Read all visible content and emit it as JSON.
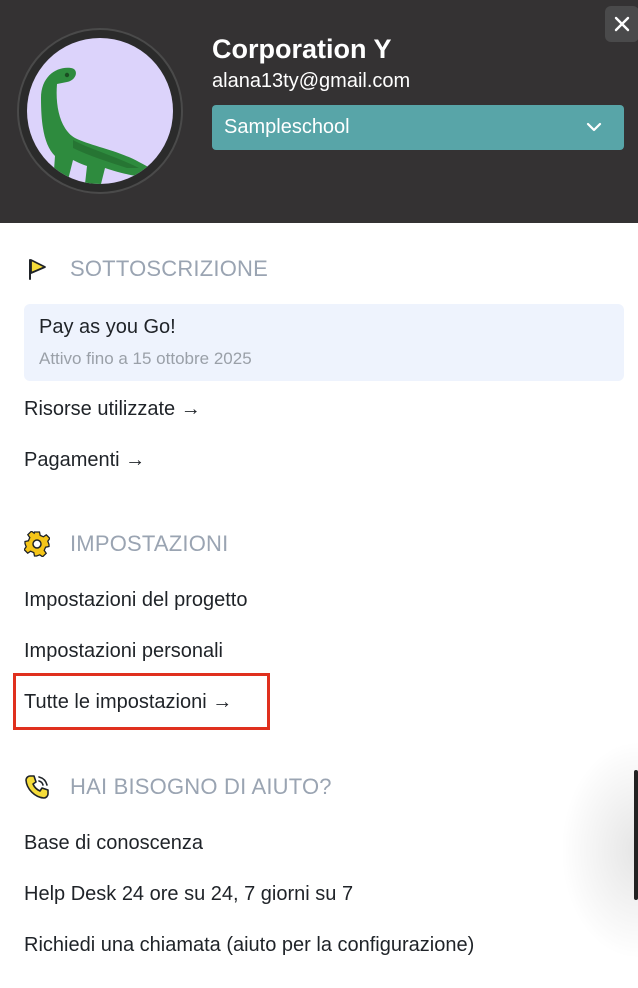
{
  "header": {
    "org_name": "Corporation Y",
    "email": "alana13ty@gmail.com",
    "school_selected": "Sampleschool",
    "background_color": "#343233",
    "select_color": "#58a5a8"
  },
  "subscription": {
    "title": "SOTTOSCRIZIONE",
    "icon": "flag-icon",
    "plan_name": "Pay as you Go!",
    "plan_until": "Attivo fino a 15 ottobre 2025",
    "links": [
      "Risorse utilizzate →",
      "Pagamenti →"
    ]
  },
  "settings": {
    "title": "IMPOSTAZIONI",
    "icon": "gear-icon",
    "links": [
      "Impostazioni del progetto",
      "Impostazioni personali",
      "Tutte le impostazioni →"
    ],
    "highlight_color": "#e0301e"
  },
  "help": {
    "title": "HAI BISOGNO DI AIUTO?",
    "icon": "phone-icon",
    "links": [
      "Base di conoscenza",
      "Help Desk 24 ore su 24, 7 giorni su 7",
      "Richiedi una chiamata (aiuto per la configurazione)"
    ]
  }
}
